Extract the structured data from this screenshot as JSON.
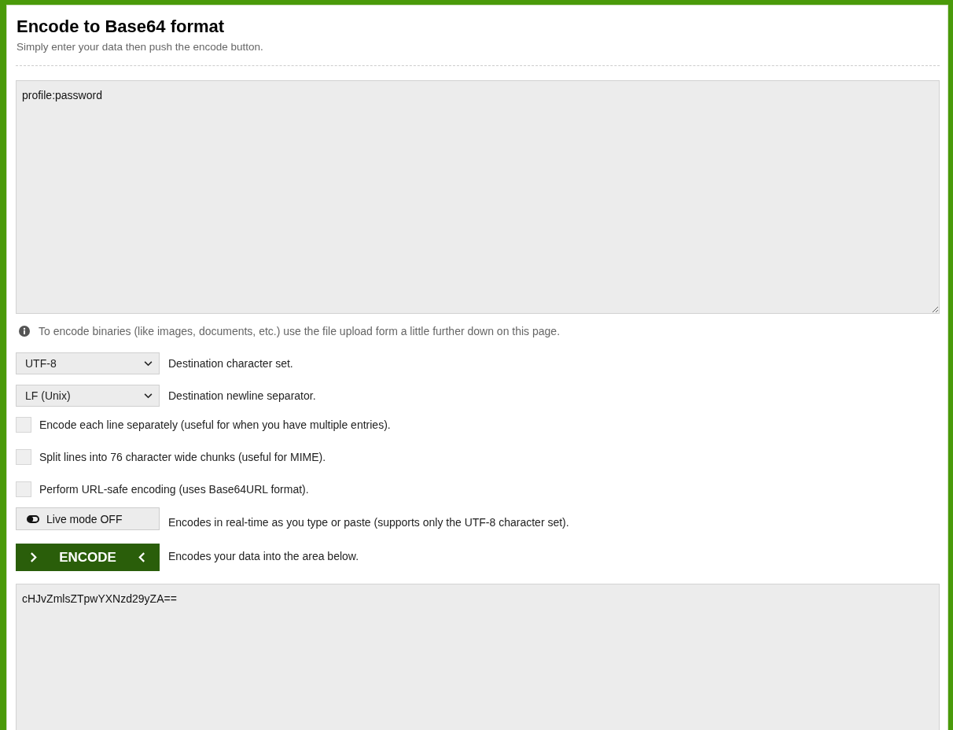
{
  "title": "Encode to Base64 format",
  "subtitle": "Simply enter your data then push the encode button.",
  "input": {
    "value": "profile:password"
  },
  "info_note": "To encode binaries (like images, documents, etc.) use the file upload form a little further down on this page.",
  "selects": [
    {
      "value": "UTF-8",
      "label": "Destination character set."
    },
    {
      "value": "LF (Unix)",
      "label": "Destination newline separator."
    }
  ],
  "checkboxes": [
    {
      "label": "Encode each line separately (useful for when you have multiple entries).",
      "checked": false
    },
    {
      "label": "Split lines into 76 character wide chunks (useful for MIME).",
      "checked": false
    },
    {
      "label": "Perform URL-safe encoding (uses Base64URL format).",
      "checked": false
    }
  ],
  "live_mode": {
    "label": "Live mode OFF",
    "on": false,
    "description": "Encodes in real-time as you type or paste (supports only the UTF-8 character set)."
  },
  "encode": {
    "label": "ENCODE",
    "description": "Encodes your data into the area below."
  },
  "output": {
    "value": "cHJvZmlsZTpwYXNzd29yZA=="
  }
}
